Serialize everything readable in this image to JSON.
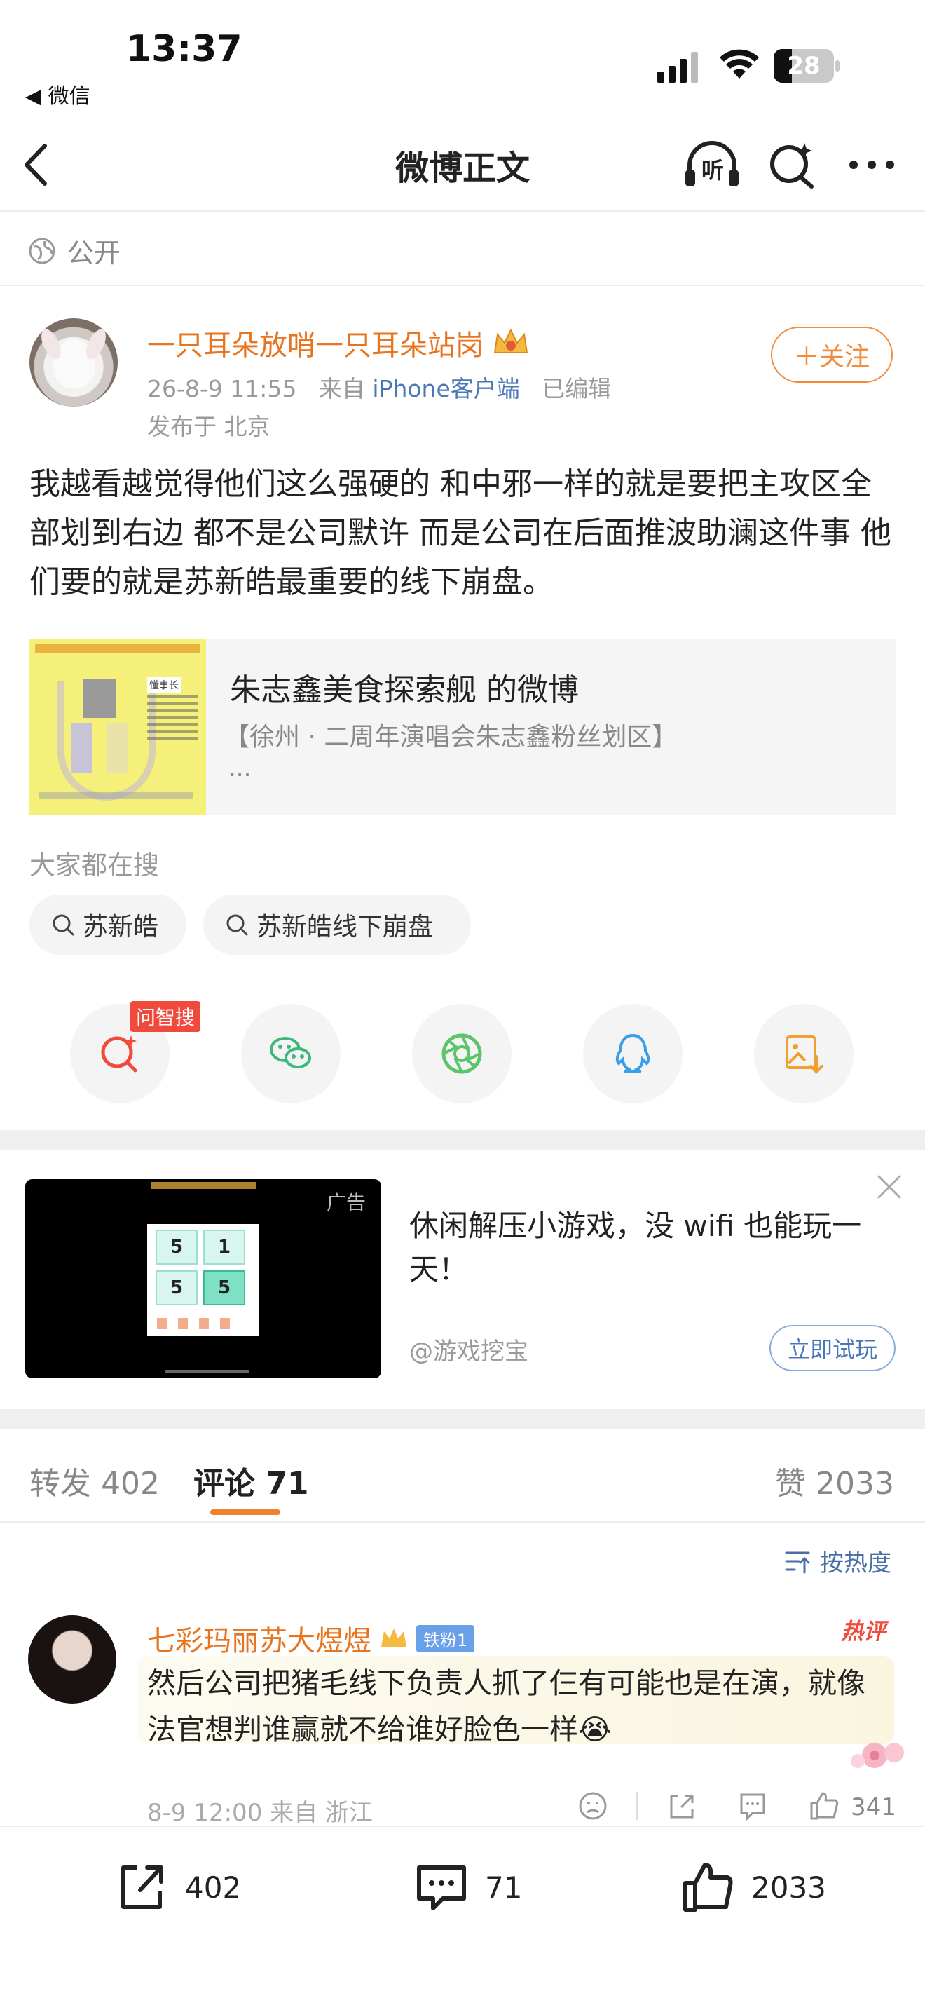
{
  "status_bar": {
    "time": "13:37",
    "back_app": "◀ 微信",
    "battery": "28"
  },
  "nav": {
    "title": "微博正文",
    "listen_label": "听"
  },
  "visibility": "公开",
  "post": {
    "username": "一只耳朵放哨一只耳朵站岗",
    "date": "26-8-9 11:55",
    "from_prefix": "来自",
    "client": "iPhone客户端",
    "edited": "已编辑",
    "location": "发布于 北京",
    "follow_label": "＋关注",
    "body": "我越看越觉得他们这么强硬的 和中邪一样的就是要把主攻区全部划到右边 都不是公司默许 而是公司在后面推波助澜这件事 他们要的就是苏新皓最重要的线下崩盘。",
    "repost_card": {
      "title": "朱志鑫美食探索舰 的微博",
      "subtitle": "【徐州 · 二周年演唱会朱志鑫粉丝划区】",
      "ellipsis": "...",
      "image_label": "懂事长"
    }
  },
  "hot_search": {
    "title": "大家都在搜",
    "chips": [
      "苏新皓",
      "苏新皓线下崩盘"
    ]
  },
  "share": {
    "ask_badge": "问智搜",
    "items": [
      "search-ai-icon",
      "wechat-icon",
      "moments-icon",
      "qq-icon",
      "save-image-icon"
    ]
  },
  "ad": {
    "tag": "广告",
    "text": "休闲解压小游戏，没 wifi 也能玩一天！",
    "source": "@游戏挖宝",
    "button": "立即试玩",
    "tiles": [
      "5",
      "1",
      "5",
      "5"
    ]
  },
  "tabs": {
    "repost": "转发 402",
    "comments": "评论 71",
    "likes": "赞 2033"
  },
  "sort_label": "按热度",
  "comment": {
    "username": "七彩玛丽苏大煜煜",
    "fan_badge": "铁粉1",
    "hot_tag": "热评",
    "text": "然后公司把猪毛线下负责人抓了仨有可能也是在演，就像法官想判谁赢就不给谁好脸色一样😭",
    "meta": "8-9 12:00  来自 浙江",
    "like_count": "341"
  },
  "bottom_bar": {
    "repost_count": "402",
    "comment_count": "71",
    "like_count": "2033"
  },
  "colors": {
    "accent_orange": "#e8741f",
    "link_blue": "#4a78b5",
    "badge_red": "#f04a3d"
  }
}
